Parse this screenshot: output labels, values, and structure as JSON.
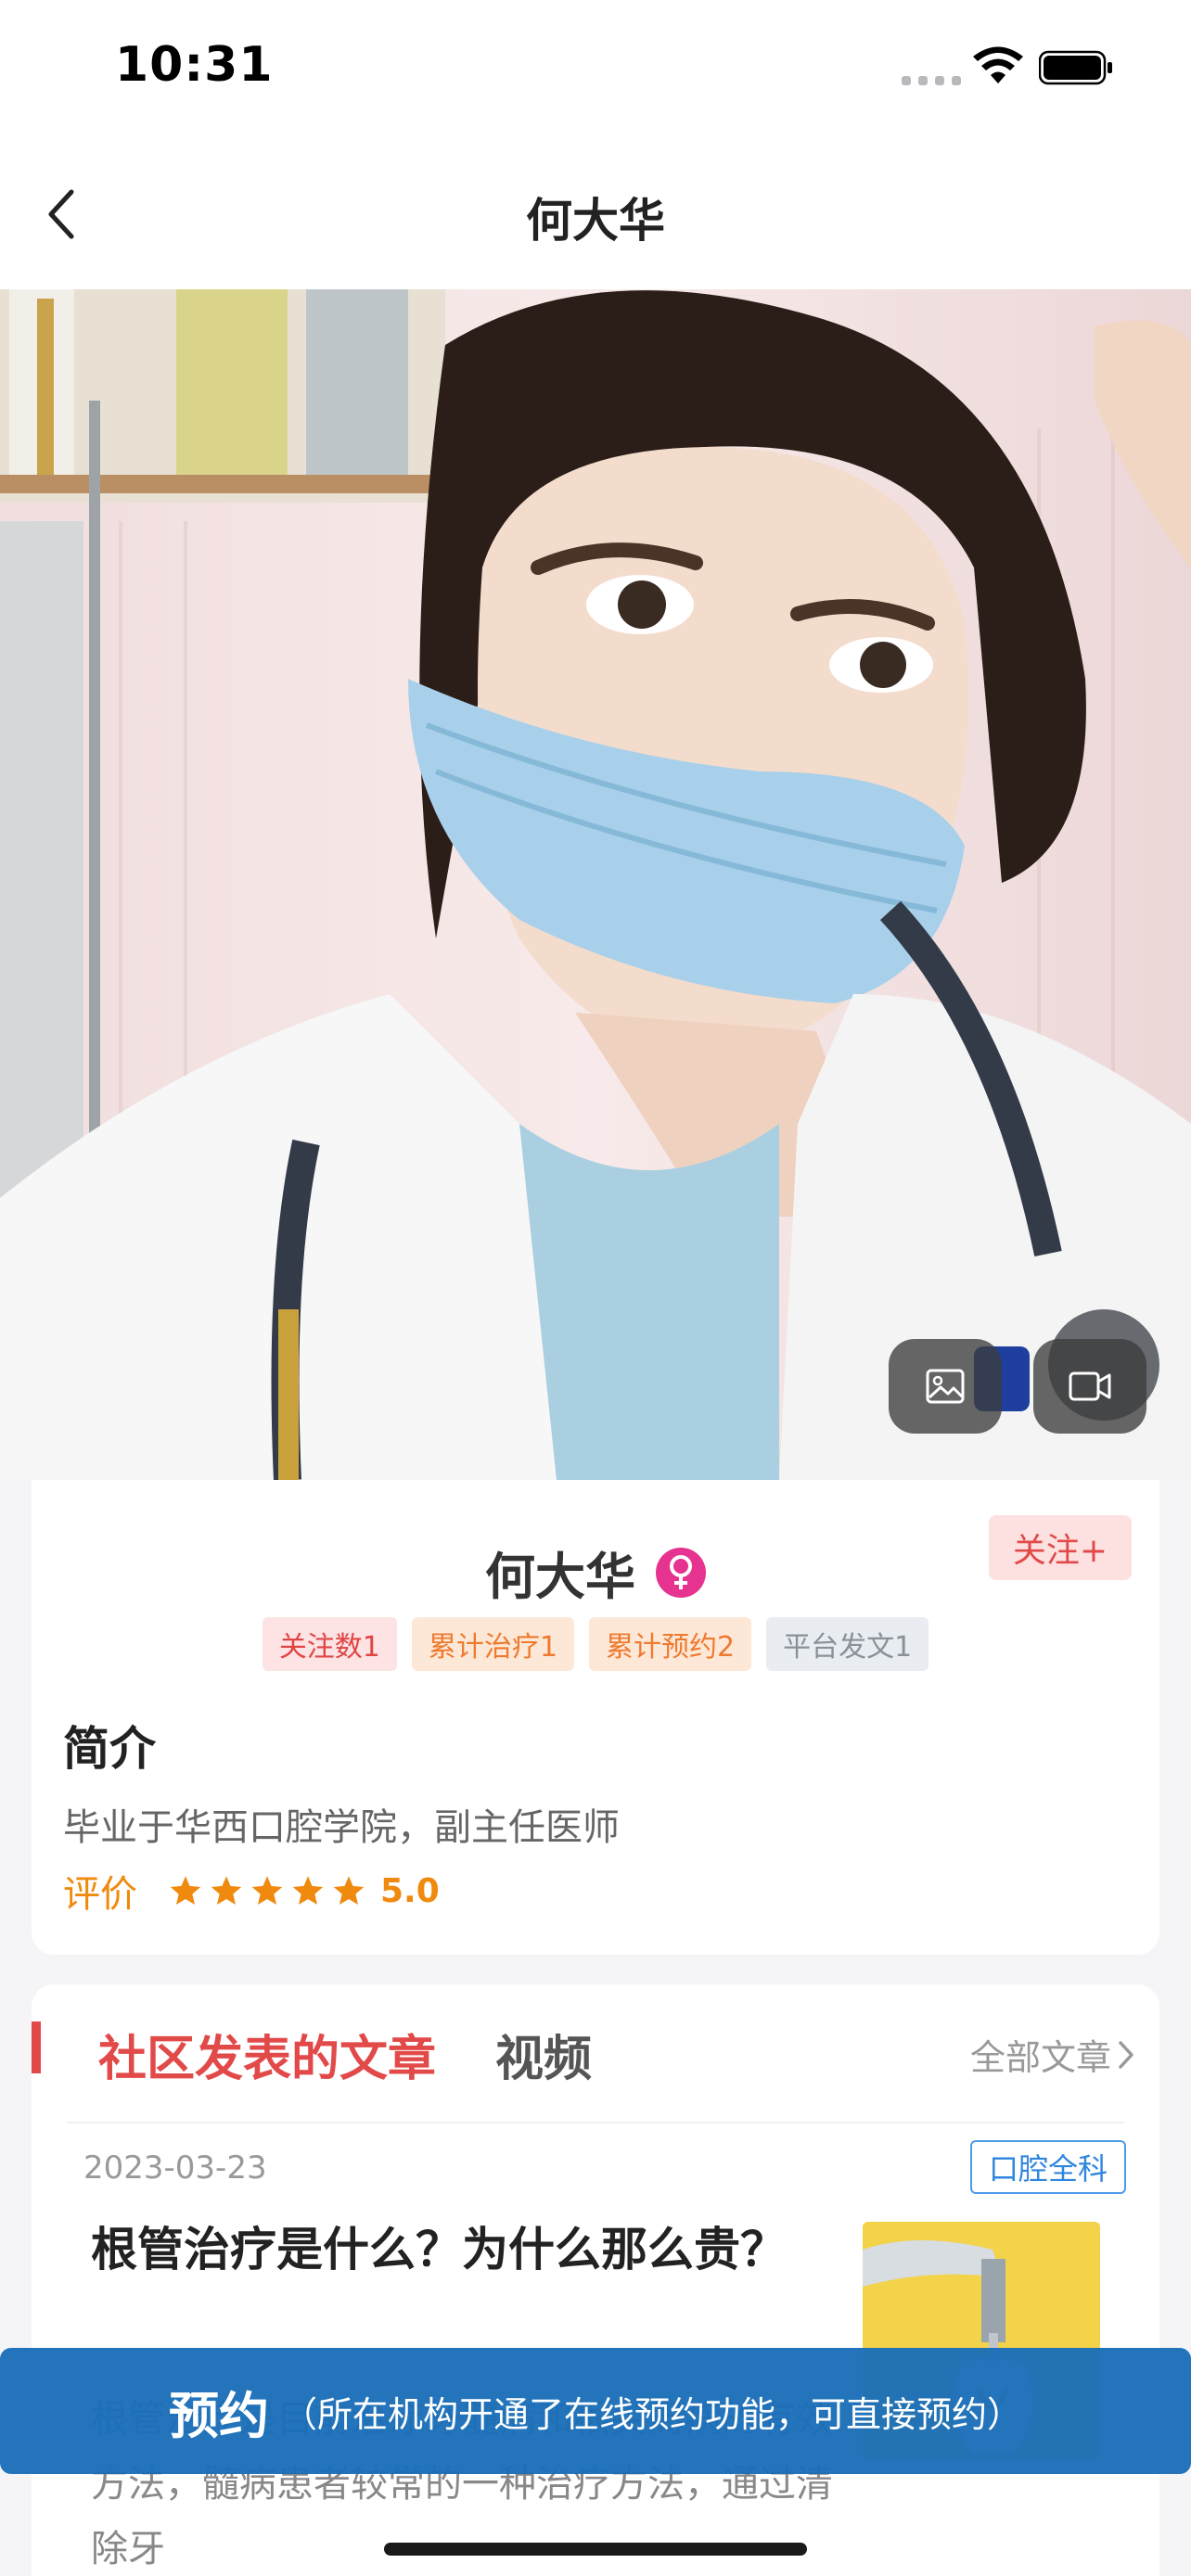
{
  "status_bar": {
    "time": "10:31"
  },
  "nav": {
    "title": "何大华"
  },
  "photo": {
    "image_button_icon": "image-icon",
    "video_button_icon": "video-icon"
  },
  "profile": {
    "name": "何大华",
    "gender_icon": "female-icon",
    "follow_label": "关注+",
    "stats": [
      "关注数1",
      "累计治疗1",
      "累计预约2",
      "平台发文1"
    ],
    "intro_title": "简介",
    "intro_text": "毕业于华西口腔学院，副主任医师",
    "rating_label": "评价",
    "rating_stars": 5,
    "rating_score": "5.0"
  },
  "articles": {
    "tab_articles": "社区发表的文章",
    "tab_video": "视频",
    "all_label": "全部文章",
    "item": {
      "date": "2023-03-23",
      "tag": "口腔全科",
      "title": "根管治疗是什么？为什么那么贵？",
      "excerpt": "根管治疗是目前治疗牙髓病和根尖周病的有效方法，髓病患者较常的一种治疗方法，通过清除牙"
    }
  },
  "booking": {
    "title": "预约",
    "desc": "（所在机构开通了在线预约功能，可直接预约）"
  },
  "colors": {
    "accent_red": "#e24a4a",
    "booking_blue": "#1a6eb8",
    "rating_orange": "#f08a0e",
    "gender_pink": "#e5338f"
  }
}
